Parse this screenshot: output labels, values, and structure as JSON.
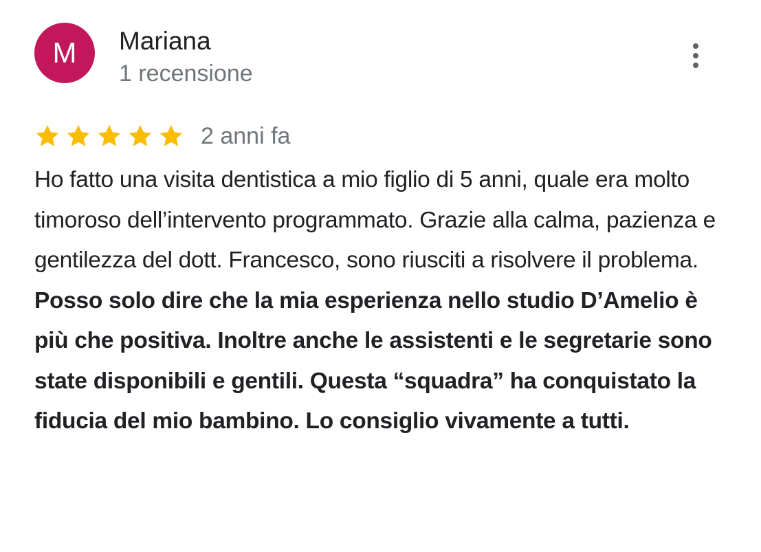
{
  "review": {
    "author": {
      "initial": "M",
      "name": "Mariana",
      "meta": "1 recensione",
      "avatar_color": "#c2185b"
    },
    "more_icon": "more-vert-icon",
    "rating": 5,
    "rating_max": 5,
    "star_color": "#fbbc04",
    "date": "2 anni fa",
    "text_regular": "Ho fatto una visita dentistica a mio figlio di 5 anni, quale era molto timoroso dell’intervento programmato. Grazie alla calma, pazienza e gentilezza del dott. Francesco, sono riusciti a risolvere il problema. ",
    "text_bold": "Posso solo dire che la mia esperienza nello studio D’Amelio è più che positiva. Inoltre anche le assistenti e le segretarie sono state disponibili e gentili. Questa “squadra” ha conquistato la fiducia del mio bambino. Lo consiglio vivamente a tutti."
  }
}
